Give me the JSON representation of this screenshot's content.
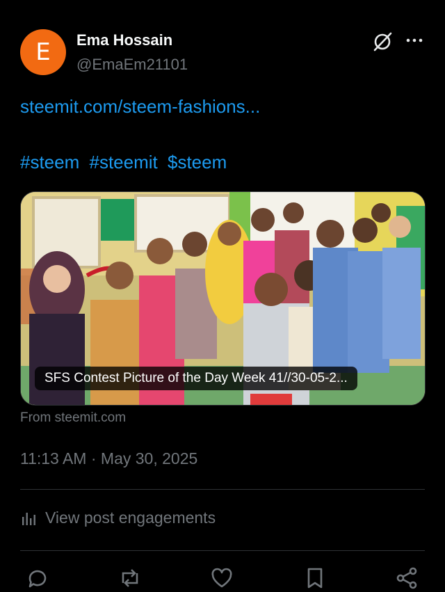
{
  "author": {
    "avatar_letter": "E",
    "avatar_color": "#f26a12",
    "name": "Ema Hossain",
    "handle": "@EmaEm21101"
  },
  "header_icons": [
    "grok-icon",
    "more-options-icon"
  ],
  "post": {
    "link": "steemit.com/steem-fashions...",
    "hashtags": [
      "#steem",
      "#steemit",
      "$steem"
    ]
  },
  "card": {
    "caption": "SFS Contest Picture of the Day Week 41//30-05-2...",
    "source": "From steemit.com"
  },
  "timestamp": "11:13 AM · May 30, 2025",
  "engagements_label": "View post engagements",
  "action_bar": [
    "reply-icon",
    "repost-icon",
    "like-icon",
    "bookmark-icon",
    "share-icon"
  ],
  "colors": {
    "background": "#000000",
    "link": "#1d9bf0",
    "muted": "#71767b",
    "divider": "#2f3336"
  }
}
